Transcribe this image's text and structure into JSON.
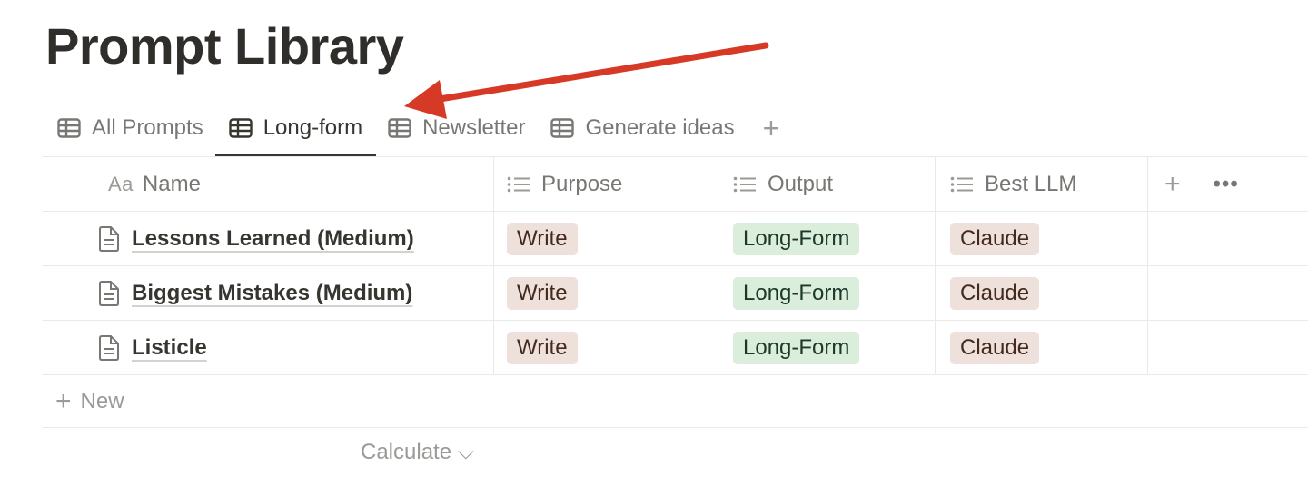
{
  "page": {
    "title": "Prompt Library"
  },
  "tabs": [
    {
      "label": "All Prompts",
      "icon": "table-icon",
      "active": false
    },
    {
      "label": "Long-form",
      "icon": "table-icon",
      "active": true
    },
    {
      "label": "Newsletter",
      "icon": "table-icon",
      "active": false
    },
    {
      "label": "Generate ideas",
      "icon": "table-icon",
      "active": false
    }
  ],
  "add_view_label": "+",
  "table": {
    "columns": [
      {
        "label": "Name",
        "type_icon": "Aa"
      },
      {
        "label": "Purpose",
        "type_icon": "list-icon"
      },
      {
        "label": "Output",
        "type_icon": "list-icon"
      },
      {
        "label": "Best LLM",
        "type_icon": "list-icon"
      }
    ],
    "add_column": "+",
    "more_options": "•••",
    "rows": [
      {
        "name": "Lessons Learned (Medium)",
        "purpose": "Write",
        "output": "Long-Form",
        "best_llm": "Claude"
      },
      {
        "name": "Biggest Mistakes (Medium)",
        "purpose": "Write",
        "output": "Long-Form",
        "best_llm": "Claude"
      },
      {
        "name": "Listicle",
        "purpose": "Write",
        "output": "Long-Form",
        "best_llm": "Claude"
      }
    ],
    "new_label": "New",
    "new_plus": "+",
    "calculate_label": "Calculate ⌵"
  },
  "colors": {
    "annotation_arrow": "#d63a26",
    "tag_brown_bg": "#eee0da",
    "tag_green_bg": "#dbeddb"
  }
}
